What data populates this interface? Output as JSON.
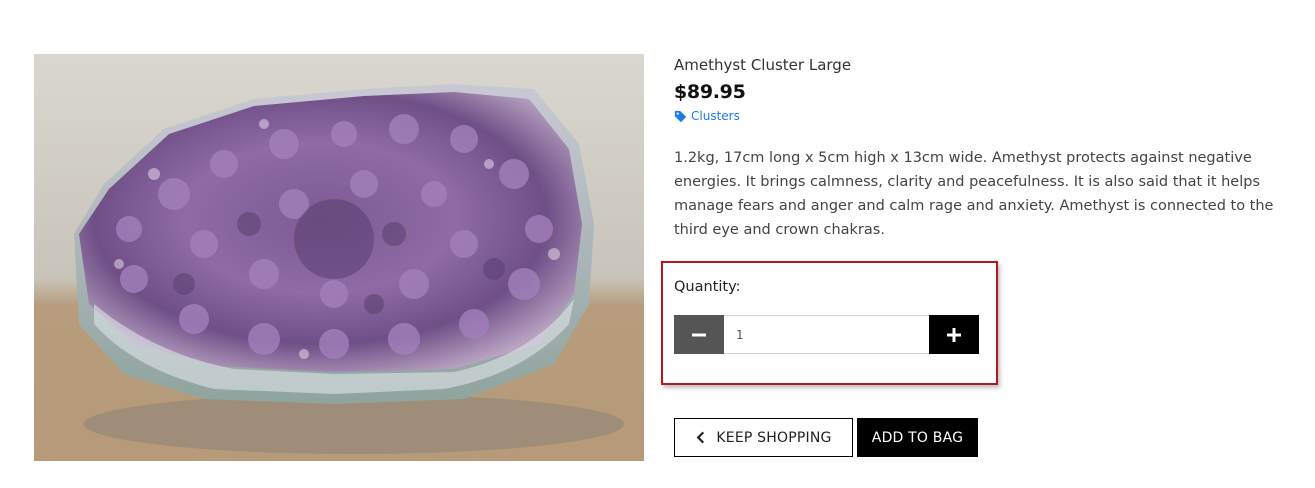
{
  "product": {
    "name": "Amethyst Cluster Large",
    "price": "$89.95",
    "category": "Clusters",
    "category_icon": "tag-icon",
    "description": "1.2kg, 17cm long x 5cm high x 13cm wide. Amethyst protects against negative energies. It brings calmness, clarity and peacefulness. It is also said that it helps manage fears and anger and calm rage and anxiety. Amethyst is connected to the third eye and crown chakras.",
    "image_alt": "Amethyst Cluster Large"
  },
  "quantity": {
    "label": "Quantity:",
    "value": "1",
    "decrement_icon": "minus-icon",
    "increment_icon": "plus-icon"
  },
  "actions": {
    "keep_shopping": "KEEP SHOPPING",
    "keep_shopping_icon": "chevron-left-icon",
    "add_to_bag": "ADD TO BAG"
  },
  "colors": {
    "link": "#1e7ae6",
    "highlight_border": "#b3181f",
    "decrement_button": "#555555",
    "increment_button": "#000000"
  }
}
